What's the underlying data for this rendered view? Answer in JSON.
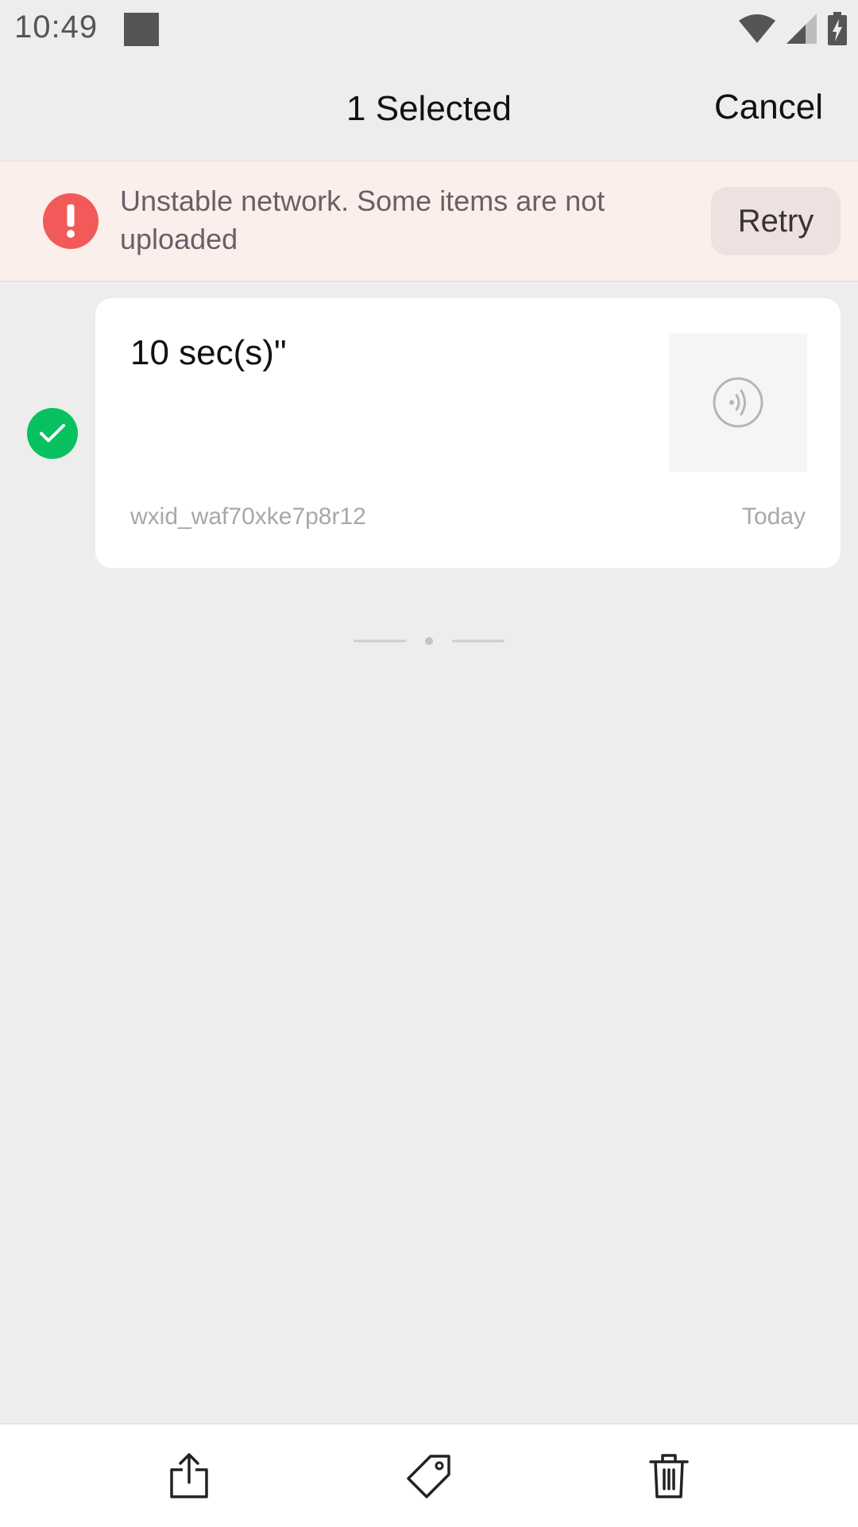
{
  "status_bar": {
    "time": "10:49"
  },
  "header": {
    "title": "1 Selected",
    "cancel_label": "Cancel"
  },
  "banner": {
    "message": "Unstable network. Some items are not uploaded",
    "retry_label": "Retry",
    "icon": "alert-icon",
    "color": "#f25a5a"
  },
  "items": [
    {
      "title": "10 sec(s)\"",
      "author": "wxid_waf70xke7p8r12",
      "date": "Today",
      "selected": true,
      "thumbnail_icon": "voice-icon"
    }
  ],
  "toolbar": {
    "icons": [
      "share-icon",
      "tag-icon",
      "delete-icon"
    ]
  },
  "colors": {
    "accent_green": "#07c160",
    "alert_red": "#f25a5a",
    "background": "#ededed"
  }
}
